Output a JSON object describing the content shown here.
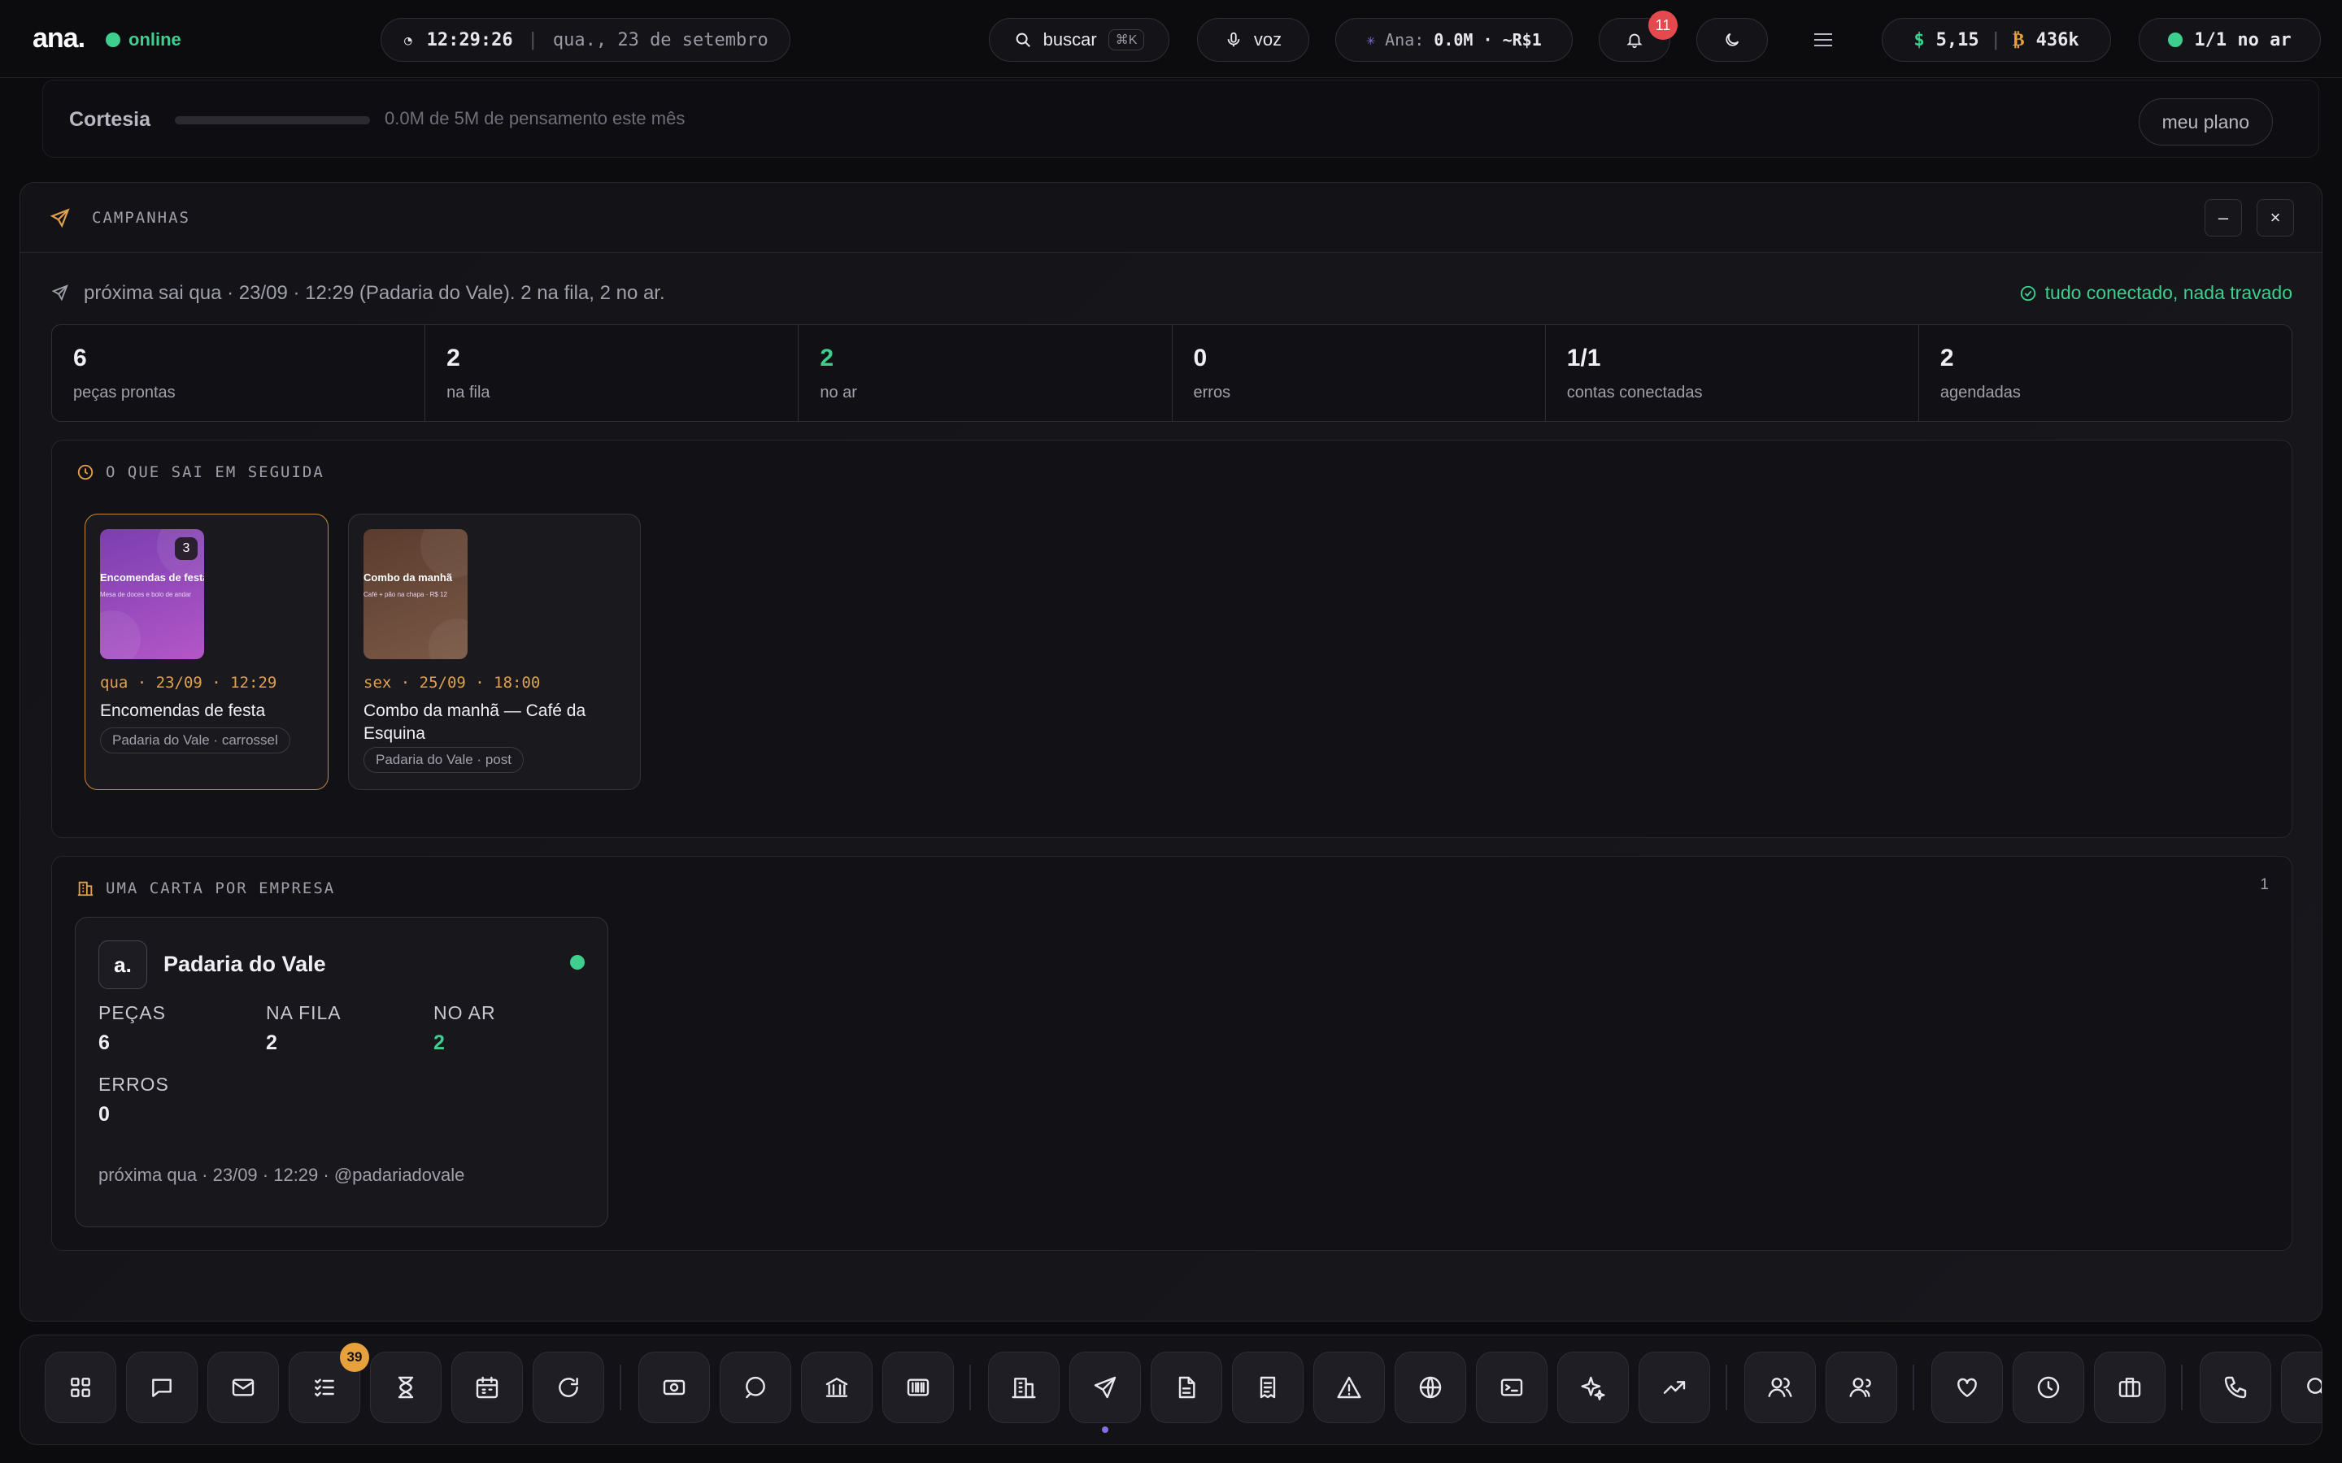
{
  "topbar": {
    "logo": "ana.",
    "status": "online",
    "time": "12:29:26",
    "date": "qua., 23 de setembro",
    "search_label": "buscar",
    "search_shortcut": "⌘K",
    "voice_label": "voz",
    "ana_prefix": "Ana:",
    "ana_usage": "0.0M · ~R$1",
    "notifications_count": "11",
    "usd_value": "5,15",
    "btc_value": "436k",
    "onair_label": "1/1 no ar"
  },
  "plan": {
    "name": "Cortesia",
    "usage_text": "0.0M de 5M de pensamento este mês",
    "usage_fraction": 0.0,
    "button_label": "meu plano"
  },
  "campaigns": {
    "title": "CAMPANHAS",
    "next_status": "próxima sai qua · 23/09 · 12:29 (Padaria do Vale). 2 na fila, 2 no ar.",
    "ok_status": "tudo conectado, nada travado",
    "stats": [
      {
        "value": "6",
        "label": "peças prontas"
      },
      {
        "value": "2",
        "label": "na fila"
      },
      {
        "value": "2",
        "label": "no ar"
      },
      {
        "value": "0",
        "label": "erros"
      },
      {
        "value": "1/1",
        "label": "contas conectadas"
      },
      {
        "value": "2",
        "label": "agendadas"
      }
    ],
    "upcoming_title": "O QUE SAI EM SEGUIDA",
    "upcoming": [
      {
        "thumb_title": "Encomendas de festa",
        "thumb_subtitle": "Mesa de doces e bolo de andar",
        "slides": "3",
        "date": "qua · 23/09 · 12:29",
        "title": "Encomendas de festa",
        "tag": "Padaria do Vale · carrossel"
      },
      {
        "thumb_title": "Combo da manhã",
        "thumb_subtitle": "Café + pão na chapa · R$ 12",
        "date": "sex · 25/09 · 18:00",
        "title": "Combo da manhã — Café da Esquina",
        "tag": "Padaria do Vale · post"
      }
    ],
    "companies_title": "UMA CARTA POR EMPRESA",
    "companies_count": "1",
    "company": {
      "logo": "a.",
      "name": "Padaria do Vale",
      "pecas_label": "PEÇAS",
      "pecas_value": "6",
      "fila_label": "NA FILA",
      "fila_value": "2",
      "ar_label": "NO AR",
      "ar_value": "2",
      "erros_label": "ERROS",
      "erros_value": "0",
      "next": "próxima qua · 23/09 · 12:29 · @padariadovale"
    }
  },
  "dock": {
    "tasks_badge": "39",
    "icons": [
      "grid-icon",
      "chat-icon",
      "mail-icon",
      "checklist-icon",
      "hourglass-icon",
      "calendar-icon",
      "refresh-icon",
      "money-icon",
      "comment-icon",
      "bank-icon",
      "barcode-icon",
      "building-icon",
      "send-icon",
      "document-icon",
      "receipt-icon",
      "alert-icon",
      "globe-icon",
      "terminal-icon",
      "sparkles-icon",
      "trending-icon",
      "user-icon",
      "users-icon",
      "heart-icon",
      "clock-icon",
      "briefcase-icon",
      "phone-icon",
      "search-icon"
    ]
  },
  "colors": {
    "accent_green": "#3ecf8e",
    "accent_orange": "#e0a14e",
    "badge_red": "#e5484d"
  }
}
